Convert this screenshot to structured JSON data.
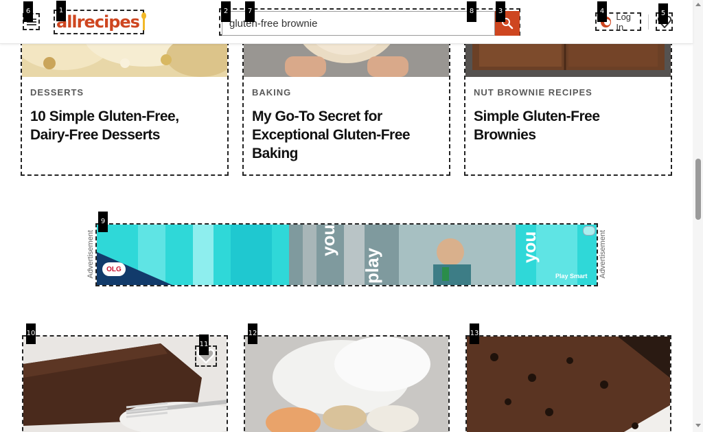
{
  "header": {
    "logo_text": "allrecipes",
    "search_value": "gluten-free brownie",
    "login_label": "Log In"
  },
  "overlay_tags": {
    "t1": "1",
    "t2": "2",
    "t3": "3",
    "t4": "4",
    "t5": "5",
    "t6": "6",
    "t7": "7",
    "t8": "8",
    "t9": "9",
    "t10": "10",
    "t11": "11",
    "t12": "12",
    "t13": "13"
  },
  "cards_top": [
    {
      "category": "DESSERTS",
      "title": "10 Simple Gluten-Free, Dairy-Free Desserts"
    },
    {
      "category": "BAKING",
      "title": "My Go-To Secret for Exceptional Gluten-Free Baking"
    },
    {
      "category": "NUT BROWNIE RECIPES",
      "title": "Simple Gluten-Free Brownies"
    }
  ],
  "ad": {
    "label_left": "Advertisement",
    "label_right": "Advertisement",
    "brand": "OLG",
    "word_you": "you",
    "word_play": "play",
    "word_you2": "you",
    "tagline": "Play Smart"
  },
  "colors": {
    "brand": "#ce4620",
    "accent_yellow": "#f2b827",
    "ad_teal": "#2fd8d8"
  },
  "icons": [
    "menu-icon",
    "search-icon",
    "user-icon",
    "heart-icon",
    "heart-outline-icon",
    "ad-choices-icon"
  ]
}
